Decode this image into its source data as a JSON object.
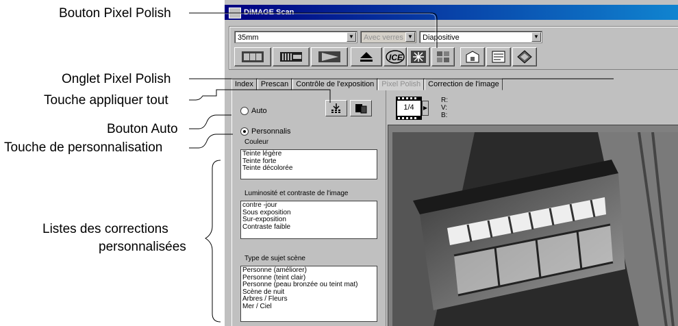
{
  "callouts": {
    "pixel_polish_button": "Bouton Pixel Polish",
    "pixel_polish_tab": "Onglet Pixel Polish",
    "apply_all": "Touche appliquer tout",
    "auto_button": "Bouton Auto",
    "personalise_button": "Touche de personnalisation",
    "lists_line1": "Listes des corrections",
    "lists_line2": "personnalisées"
  },
  "window": {
    "title": "DiMAGE Scan"
  },
  "toolbar": {
    "film_format": "35mm",
    "holder": "Avec verres",
    "film_type": "Diapositive"
  },
  "tabs": [
    "Index",
    "Prescan",
    "Contrôle de l'exposition",
    "Pixel Polish",
    "Correction de l'image"
  ],
  "panel": {
    "auto_label": "Auto",
    "custom_label": "Personnalis",
    "color_group": "Couleur",
    "color_items": [
      "Teinte légère",
      "Teinte forte",
      "Teinte décolorée"
    ],
    "brightness_group": "Luminosité et contraste de l'image",
    "brightness_items": [
      "contre -jour",
      "Sous exposition",
      "Sur-exposition",
      "Contraste faible"
    ],
    "subject_group": "Type de sujet  scène",
    "subject_items": [
      "Personne (améliorer)",
      "Personne (teint clair)",
      "Personne (peau bronzée ou teint mat)",
      "Scène de nuit",
      "Arbres / Fleurs",
      "Mer / Ciel"
    ]
  },
  "frame_counter": "1/4",
  "readout": {
    "r": "R:",
    "v": "V:",
    "b": "B:"
  },
  "colors": {
    "title_start": "#000080",
    "title_end": "#1084d0",
    "face": "#c0c0c0"
  }
}
